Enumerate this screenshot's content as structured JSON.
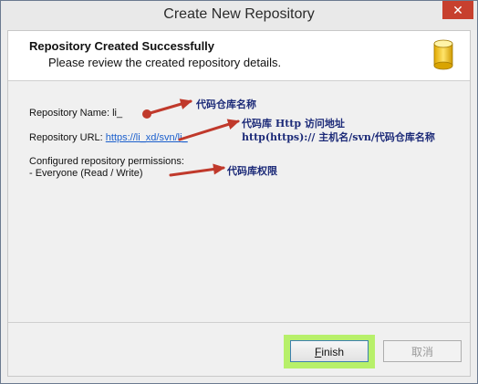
{
  "window": {
    "title": "Create New Repository",
    "close_symbol": "✕"
  },
  "header": {
    "title": "Repository Created Successfully",
    "subtitle": "Please review the created repository details.",
    "icon": "database-icon"
  },
  "details": {
    "name_label": "Repository Name: li_",
    "url_label": "Repository URL:",
    "url_value": "https://li_xd/svn/li_",
    "permissions_label": "Configured repository permissions:",
    "permissions_value": "- Everyone (Read / Write)"
  },
  "annotations": {
    "name": "代码仓库名称",
    "url_line1": "代码库 Http 访问地址",
    "url_line2": "http(https):// 主机名/svn/代码仓库名称",
    "permissions": "代码库权限",
    "arrow_color": "#c0392b"
  },
  "buttons": {
    "finish_mnemonic": "F",
    "finish_rest": "inish",
    "cancel": "取消"
  },
  "colors": {
    "highlight": "#b7f06a",
    "link": "#1a5ecc",
    "close": "#c7402e"
  }
}
